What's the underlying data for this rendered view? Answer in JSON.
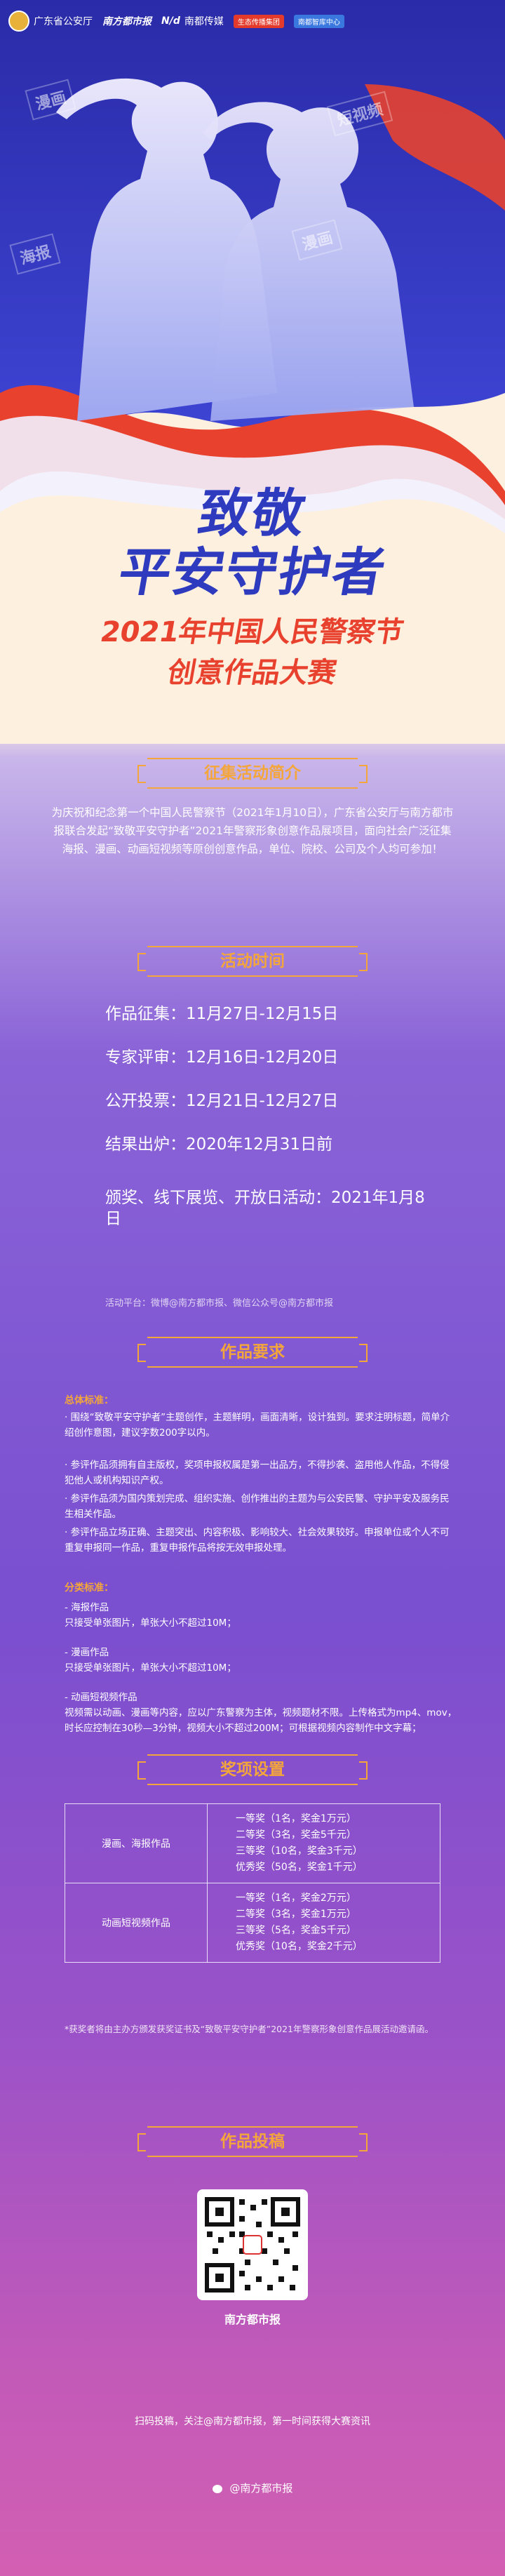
{
  "header": {
    "logo_police": "广东省公安厅",
    "logo_nanfang": "南方都市报",
    "logo_ndmedia": "南都传媒",
    "badge_red": "生态传播集团",
    "badge_blue": "南都智库中心"
  },
  "deco_tags": [
    "漫画",
    "短视频",
    "海报",
    "漫画"
  ],
  "title": {
    "line1": "致敬",
    "line2": "平安守护者",
    "line3": "2021年中国人民警察节",
    "line4": "创意作品大赛"
  },
  "sections": {
    "intro_title": "征集活动简介",
    "schedule_title": "活动时间",
    "requirements_title": "作品要求",
    "awards_title": "奖项设置",
    "submit_title": "作品投稿"
  },
  "intro_text": "为庆祝和纪念第一个中国人民警察节（2021年1月10日），广东省公安厅与南方都市报联合发起“致敬平安守护者”2021年警察形象创意作品展项目，面向社会广泛征集海报、漫画、动画短视频等原创创意作品，单位、院校、公司及个人均可参加！",
  "schedule": [
    "作品征集：11月27日-12月15日",
    "专家评审：12月16日-12月20日",
    "公开投票：12月21日-12月27日",
    "结果出炉：2020年12月31日前",
    "颁奖、线下展览、开放日活动：2021年1月8日"
  ],
  "platform": "活动平台：微博@南方都市报、微信公众号@南方都市报",
  "requirements": {
    "general_heading": "总体标准：",
    "general": [
      "· 围绕“致敬平安守护者”主题创作，主题鲜明，画面清晰，设计独到。要求注明标题，简单介绍创作意图，建议字数200字以内。",
      "· 参评作品须拥有自主版权，奖项申报权属是第一出品方，不得抄袭、盗用他人作品，不得侵犯他人或机构知识产权。",
      "· 参评作品须为国内策划完成、组织实施、创作推出的主题为与公安民警、守护平安及服务民生相关作品。",
      "· 参评作品立场正确、主题突出、内容积极、影响较大、社会效果较好。申报单位或个人不可重复申报同一作品，重复申报作品将按无效申报处理。"
    ],
    "categories_heading": "分类标准：",
    "categories": [
      "- 海报作品",
      "只接受单张图片，单张大小不超过10M；",
      "- 漫画作品",
      "只接受单张图片，单张大小不超过10M；",
      "- 动画短视频作品",
      "视频需以动画、漫画等内容，应以广东警察为主体，视频题材不限。上传格式为mp4、mov，时长应控制在30秒—3分钟，视频大小不超过200M；可根据视频内容制作中文字幕；"
    ]
  },
  "awards": [
    {
      "category": "漫画、海报作品",
      "items": [
        "一等奖（1名，奖金1万元）",
        "二等奖（3名，奖金5千元）",
        "三等奖（10名，奖金3千元）",
        "优秀奖（50名，奖金1千元）"
      ]
    },
    {
      "category": "动画短视频作品",
      "items": [
        "一等奖（1名，奖金2万元）",
        "二等奖（3名，奖金1万元）",
        "三等奖（5名，奖金5千元）",
        "优秀奖（10名，奖金2千元）"
      ]
    }
  ],
  "awards_note": "*获奖者将由主办方颁发获奖证书及“致敬平安守护者”2021年警察形象创意作品展活动邀请函。",
  "qr_caption": "南方都市报",
  "scan_line": "扫码投稿，关注@南方都市报，第一时间获得大赛资讯",
  "weibo": "@南方都市报"
}
